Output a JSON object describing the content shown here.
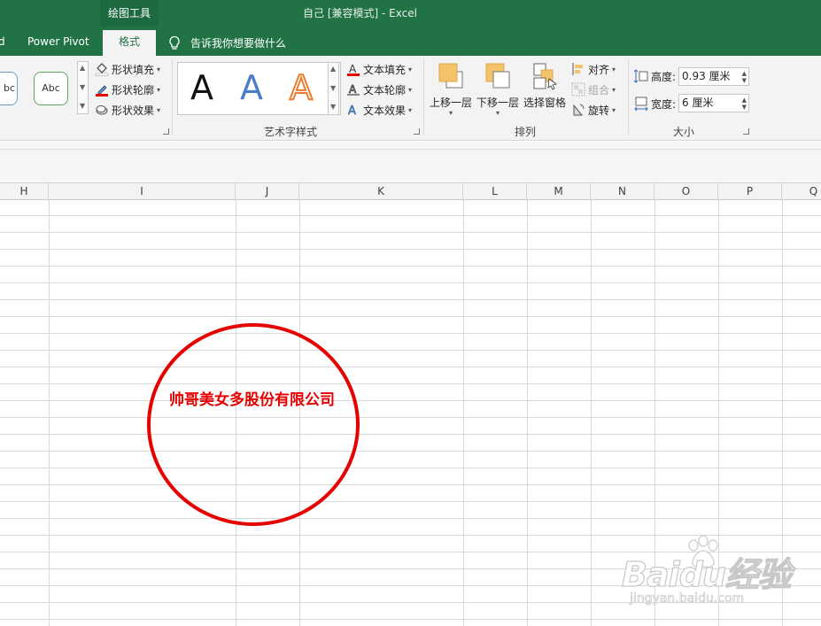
{
  "window": {
    "contextual_tool": "绘图工具",
    "title": "自己  [兼容模式]  -  Excel"
  },
  "ribbon_tabs": {
    "partial_tab": "d",
    "power_pivot": "Power Pivot",
    "format": "格式",
    "tell_me": "告诉我你想要做什么"
  },
  "shape_styles": {
    "style_1": "bc",
    "style_2": "Abc",
    "fill": "形状填充",
    "outline": "形状轮廓",
    "effects": "形状效果"
  },
  "wordart_styles": {
    "samples": [
      "A",
      "A",
      "A"
    ],
    "text_fill": "文本填充",
    "text_outline": "文本轮廓",
    "text_effects": "文本效果",
    "group_label": "艺术字样式"
  },
  "arrange": {
    "bring_forward": "上移一层",
    "send_backward": "下移一层",
    "selection_pane": "选择窗格",
    "align": "对齐",
    "group": "组合",
    "rotate": "旋转",
    "group_label": "排列"
  },
  "size": {
    "height_label": "高度:",
    "height_value": "0.93 厘米",
    "width_label": "宽度:",
    "width_value": "6 厘米",
    "group_label": "大小"
  },
  "columns": [
    "H",
    "I",
    "J",
    "K",
    "L",
    "M",
    "N",
    "O",
    "P",
    "Q"
  ],
  "stamp": {
    "text": "帅哥美女多股份有限公司",
    "color": "#e60000"
  },
  "watermark": {
    "logo": "Baidu经验",
    "url": "jingyan.baidu.com"
  },
  "colors": {
    "excel_green": "#217346",
    "ribbon_bg": "#f3f3f3"
  }
}
